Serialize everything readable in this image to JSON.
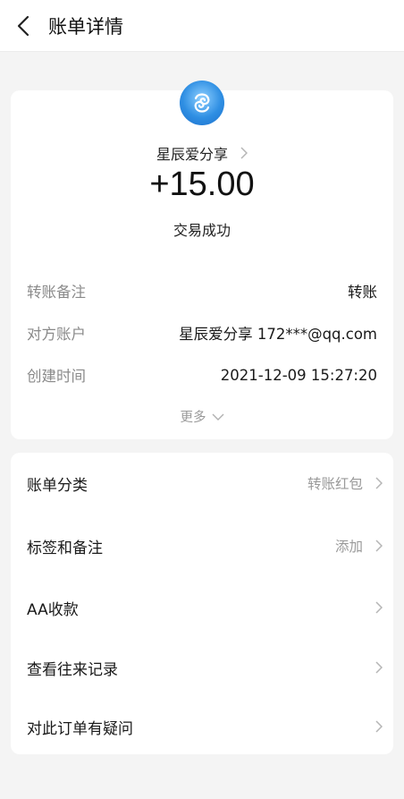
{
  "header": {
    "title": "账单详情"
  },
  "summary": {
    "merchant": "星辰爱分享",
    "amount": "+15.00",
    "status": "交易成功"
  },
  "details": [
    {
      "label": "转账备注",
      "value": "转账"
    },
    {
      "label": "对方账户",
      "value": "星辰爱分享 172***@qq.com"
    },
    {
      "label": "创建时间",
      "value": "2021-12-09 15:27:20"
    }
  ],
  "more_label": "更多",
  "menu": [
    {
      "label": "账单分类",
      "value": "转账红包"
    },
    {
      "label": "标签和备注",
      "value": "添加"
    },
    {
      "label": "AA收款",
      "value": ""
    },
    {
      "label": "查看往来记录",
      "value": ""
    },
    {
      "label": "对此订单有疑问",
      "value": ""
    }
  ],
  "colors": {
    "background": "#f4f4f4",
    "card": "#ffffff",
    "avatar_blue": "#2f8fe3",
    "secondary_text": "#8a8a8a"
  },
  "icons": [
    "back-arrow-icon",
    "chevron-right-icon",
    "chevron-down-icon",
    "merchant-avatar-icon"
  ]
}
